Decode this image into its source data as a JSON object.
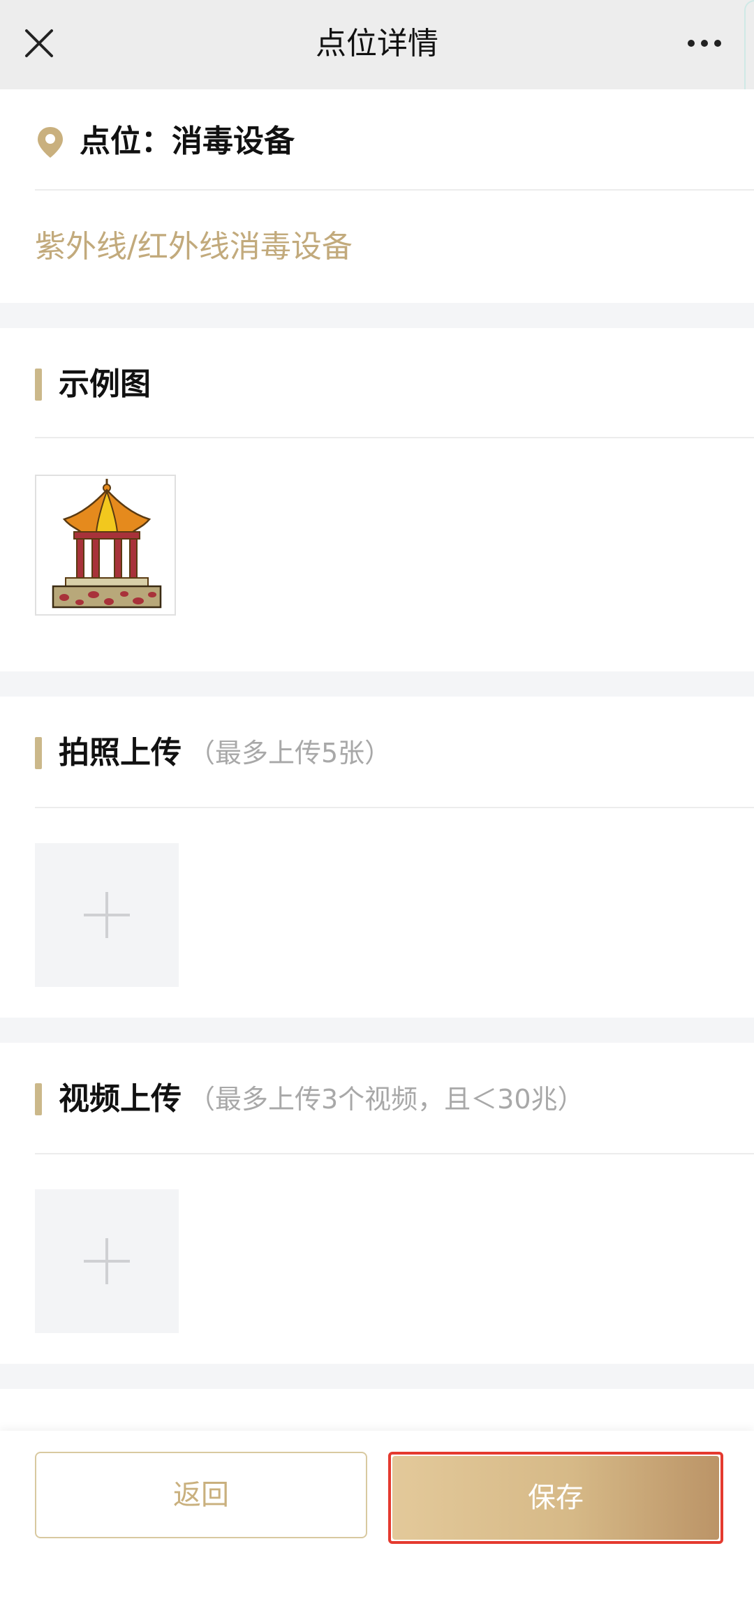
{
  "header": {
    "title": "点位详情",
    "close_icon": "close-icon",
    "more_icon": "more-dots-icon"
  },
  "point": {
    "label": "点位：消毒设备",
    "description": "紫外线/红外线消毒设备",
    "icon": "location-pin-icon"
  },
  "example_section": {
    "title": "示例图",
    "image": "pavilion-illustration"
  },
  "photo_section": {
    "title": "拍照上传",
    "hint": "（最多上传5张）"
  },
  "video_section": {
    "title": "视频上传",
    "hint": "（最多上传3个视频，且＜30兆）"
  },
  "footer": {
    "back_label": "返回",
    "save_label": "保存"
  },
  "colors": {
    "accent": "#cbb88a",
    "accent_text": "#c2aa7c",
    "save_gradient_start": "#e3c99a",
    "save_gradient_end": "#bb9467",
    "highlight_border": "#e43a2f"
  }
}
